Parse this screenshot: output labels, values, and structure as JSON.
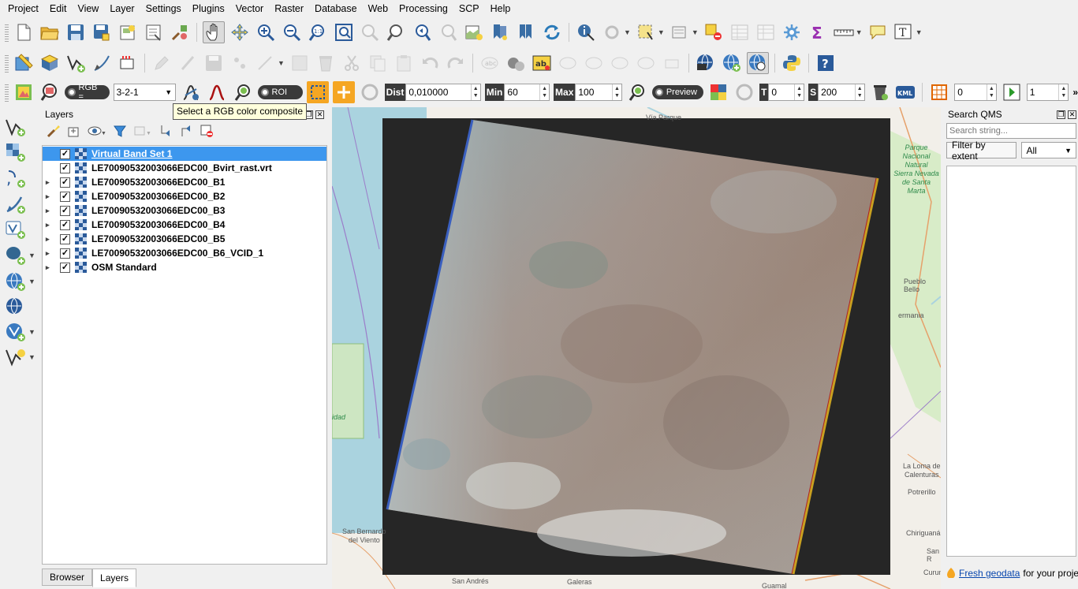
{
  "menubar": [
    "Project",
    "Edit",
    "View",
    "Layer",
    "Settings",
    "Plugins",
    "Vector",
    "Raster",
    "Database",
    "Web",
    "Processing",
    "SCP",
    "Help"
  ],
  "scp_toolbar": {
    "rgb_label": "RGB =",
    "rgb_value": "3-2-1",
    "roi_label": "ROI",
    "dist_label": "Dist",
    "dist_value": "0,010000",
    "min_label": "Min",
    "min_value": "60",
    "max_label": "Max",
    "max_value": "100",
    "preview_label": "Preview",
    "t_label": "T",
    "t_value": "0",
    "s_label": "S",
    "s_value": "200",
    "kml_label": "KML",
    "band_value": "0",
    "step_value": "1",
    "more": "»"
  },
  "tooltip": "Select a RGB color composite",
  "layers_panel": {
    "title": "Layers",
    "layers": [
      {
        "name": "Virtual Band Set 1",
        "expandable": false,
        "checked": true,
        "selected": true
      },
      {
        "name": "LE70090532003066EDC00_Bvirt_rast.vrt",
        "expandable": false,
        "checked": true,
        "selected": false
      },
      {
        "name": "LE70090532003066EDC00_B1",
        "expandable": true,
        "checked": true,
        "selected": false
      },
      {
        "name": "LE70090532003066EDC00_B2",
        "expandable": true,
        "checked": true,
        "selected": false
      },
      {
        "name": "LE70090532003066EDC00_B3",
        "expandable": true,
        "checked": true,
        "selected": false
      },
      {
        "name": "LE70090532003066EDC00_B4",
        "expandable": true,
        "checked": true,
        "selected": false
      },
      {
        "name": "LE70090532003066EDC00_B5",
        "expandable": true,
        "checked": true,
        "selected": false
      },
      {
        "name": "LE70090532003066EDC00_B6_VCID_1",
        "expandable": true,
        "checked": true,
        "selected": false
      },
      {
        "name": "OSM Standard",
        "expandable": true,
        "checked": true,
        "selected": false
      }
    ],
    "tabs": [
      "Browser",
      "Layers"
    ]
  },
  "map_labels": {
    "via_parque": "Vía Parque",
    "parque_nacional": "Parque\nNacional\nNatural\nSierra Nevada\nde Santa\nMarta",
    "pueblo_bello": "Pueblo Bello",
    "germania": "ermania",
    "idad": "idad",
    "la_loma": "La Loma de\nCalenturas",
    "potrerillo": "Potrerillo",
    "chiriguana": "Chiriguaná",
    "san_bernardo": "San Bernardo\ndel Viento",
    "san_andres": "San Andrés",
    "galeras": "Galeras",
    "guamal": "Guamal",
    "curumani": "Curum",
    "san_r": "San R"
  },
  "qms_panel": {
    "title": "Search QMS",
    "search_placeholder": "Search string...",
    "filter_label": "Filter by extent",
    "filter_select": "All",
    "footer_link": "Fresh geodata",
    "footer_text": "for your project"
  },
  "colors": {
    "selection": "#3d97ee",
    "raster_bg": "#262626",
    "sea": "#aad3df",
    "land": "#f2efe9"
  }
}
